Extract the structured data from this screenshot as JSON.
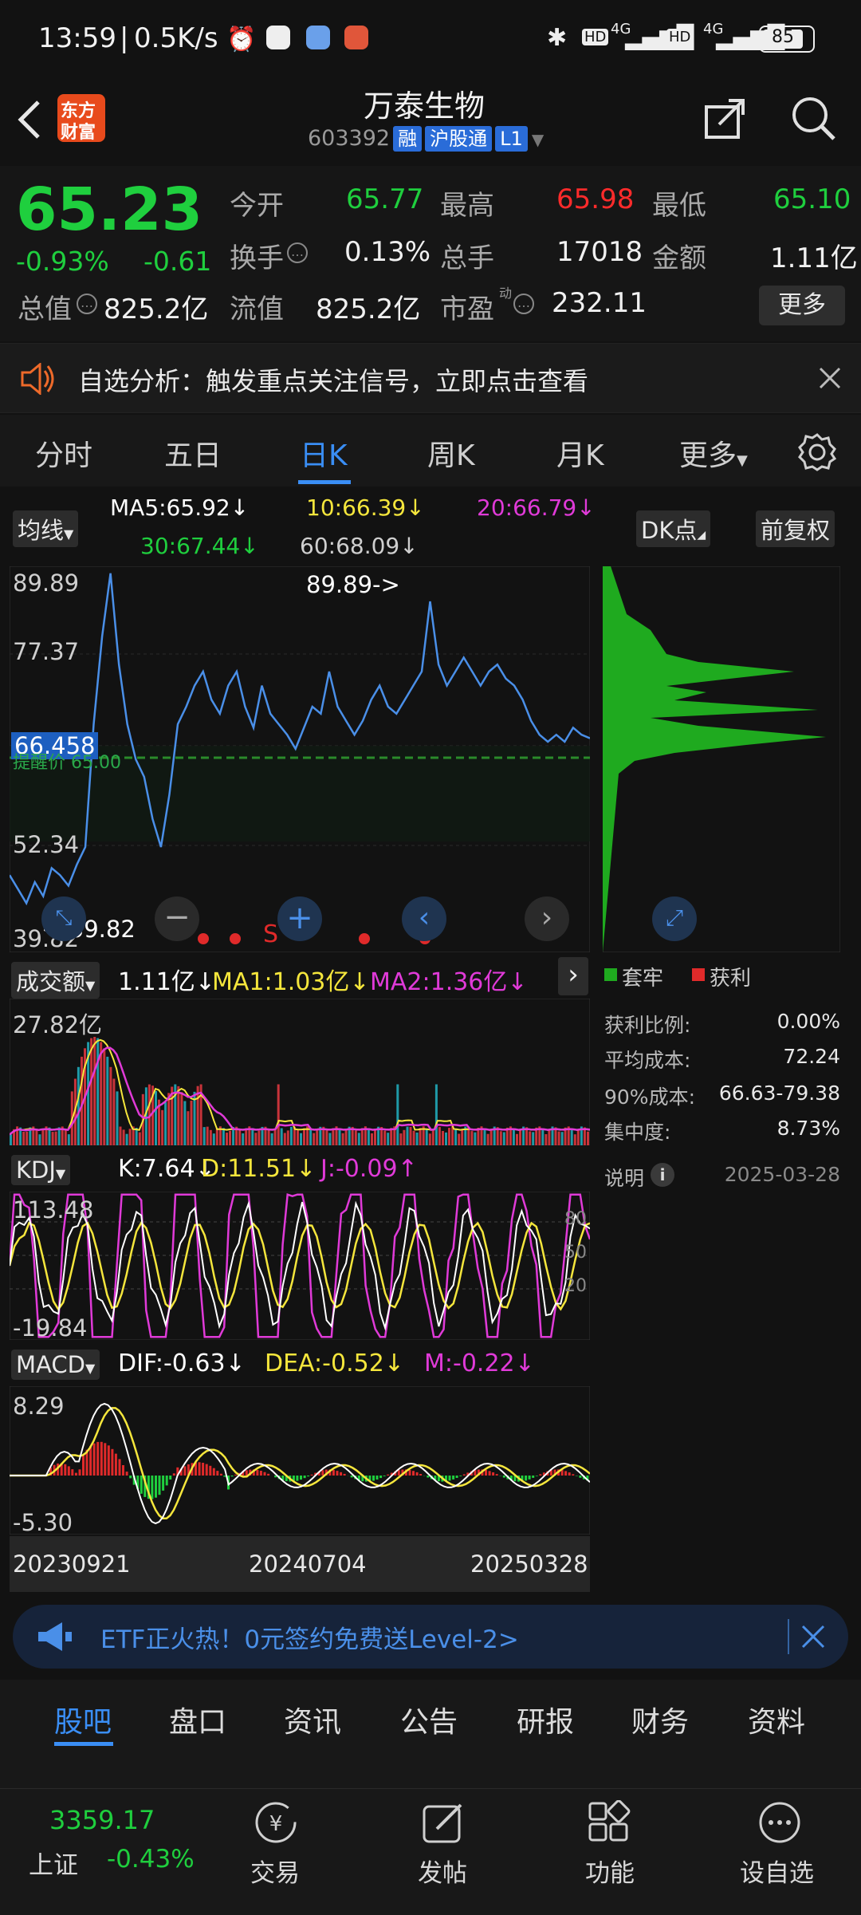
{
  "status": {
    "time": "13:59",
    "speed": "0.5K/s",
    "net1": "4G",
    "net2": "4G",
    "battery": "85"
  },
  "header": {
    "brand_line1": "东方",
    "brand_line2": "财富",
    "title": "万泰生物",
    "code": "603392",
    "badge1": "融",
    "badge2": "沪股通",
    "badge3": "L1"
  },
  "quote": {
    "price": "65.23",
    "change_pct": "-0.93%",
    "change": "-0.61",
    "open_label": "今开",
    "open": "65.77",
    "high_label": "最高",
    "high": "65.98",
    "low_label": "最低",
    "low": "65.10",
    "turnover_label": "换手",
    "turnover": "0.13%",
    "volume_label": "总手",
    "volume": "17018",
    "amount_label": "金额",
    "amount": "1.11亿",
    "mcap_label": "总值",
    "mcap": "825.2亿",
    "float_label": "流值",
    "float": "825.2亿",
    "pe_label": "市盈",
    "pe_sup": "动",
    "pe": "232.11",
    "more_button": "更多"
  },
  "notice": {
    "text": "自选分析：触发重点关注信号，立即点击查看"
  },
  "period_tabs": [
    "分时",
    "五日",
    "日K",
    "周K",
    "月K",
    "更多"
  ],
  "chart": {
    "ma_selector": "均线",
    "ma5": "MA5:65.92↓",
    "ma10": "10:66.39↓",
    "ma20": "20:66.79↓",
    "ma30": "30:67.44↓",
    "ma60": "60:68.09↓",
    "dk_button": "DK点",
    "fq_button": "前复权",
    "price_max": "89.89",
    "price_2": "77.37",
    "price_cur": "66.458",
    "price_3": "52.34",
    "price_min": "39.82",
    "max_marker": "89.89->",
    "min_marker": "<-39.82",
    "reminder": "提醒价 65.00",
    "s_marker": "S",
    "vol_selector": "成交额",
    "vol_value": "1.11亿↓",
    "vol_ma1": "MA1:1.03亿↓",
    "vol_ma2": "MA2:1.36亿↓",
    "vol_max": "27.82亿",
    "kdj_selector": "KDJ",
    "kdj_k": "K:7.64↓",
    "kdj_d": "D:11.51↓",
    "kdj_j": "J:-0.09↑",
    "kdj_max": "113.48",
    "kdj_min": "-19.84",
    "kdj_80": "80",
    "kdj_50": "50",
    "kdj_20": "20",
    "macd_selector": "MACD",
    "macd_dif": "DIF:-0.63↓",
    "macd_dea": "DEA:-0.52↓",
    "macd_m": "M:-0.22↓",
    "macd_max": "8.29",
    "macd_min": "-5.30",
    "dates": [
      "20230921",
      "20240704",
      "20250328"
    ]
  },
  "chip": {
    "legend_trapped": "套牢",
    "legend_profit": "获利",
    "rows": [
      {
        "label": "获利比例:",
        "value": "0.00%"
      },
      {
        "label": "平均成本:",
        "value": "72.24"
      },
      {
        "label": "90%成本:",
        "value": "66.63-79.38"
      },
      {
        "label": "集中度:",
        "value": "8.73%"
      }
    ],
    "explain": "说明",
    "date": "2025-03-28"
  },
  "banner": {
    "text": "ETF正火热！0元签约免费送Level-2>"
  },
  "bottom_tabs": [
    "股吧",
    "盘口",
    "资讯",
    "公告",
    "研报",
    "财务",
    "资料"
  ],
  "index": {
    "value": "3359.17",
    "name": "上证",
    "change": "-0.43%"
  },
  "nav": {
    "trade": "交易",
    "post": "发帖",
    "func": "功能",
    "watch": "设自选"
  },
  "colors": {
    "up": "#ff2b2b",
    "down": "#1fcf3e",
    "accent": "#3a8ef5",
    "ma5": "#ffffff",
    "ma10": "#f5e63c",
    "ma20": "#e03ad8",
    "ma30": "#1fcf3e"
  }
}
